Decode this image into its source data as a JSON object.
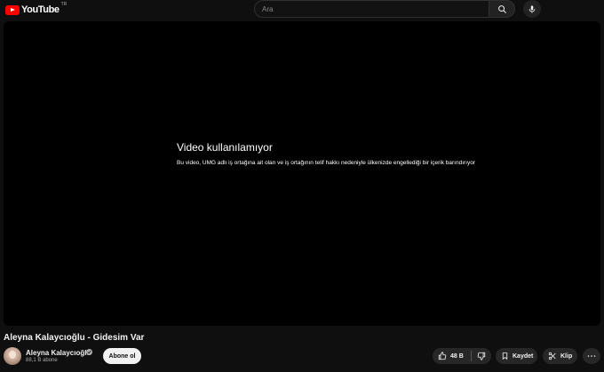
{
  "header": {
    "logo_text": "YouTube",
    "region": "TR",
    "search_placeholder": "Ara"
  },
  "player": {
    "error_title": "Video kullanılamıyor",
    "error_message": "Bu video, UMG adlı iş ortağına ait olan ve iş ortağının telif hakkı nedeniyle ülkenizde engellediği bir içerik barındırıyor"
  },
  "video": {
    "title": "Aleyna Kalaycıoğlu - Gidesim Var"
  },
  "channel": {
    "name": "Aleyna Kalaycıoğlu",
    "subscribers": "88,1 B abone",
    "subscribe_label": "Abone ol"
  },
  "actions": {
    "likes": "48 B",
    "save_label": "Kaydet",
    "clip_label": "Klip"
  },
  "colors": {
    "background": "#0f0f0f",
    "brand_red": "#ff0000",
    "pill": "#272727"
  }
}
